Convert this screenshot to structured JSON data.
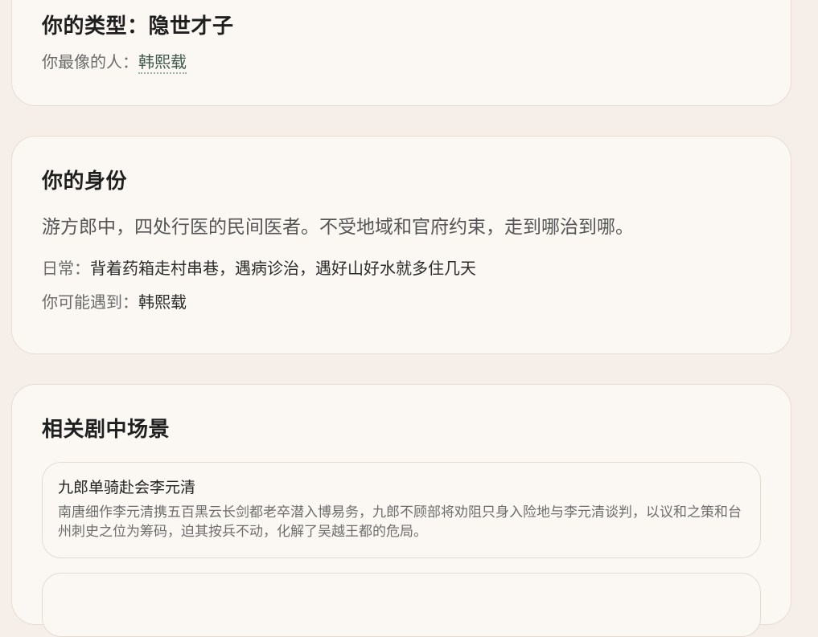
{
  "type_card": {
    "title": "你的类型：隐世才子",
    "resemble_label": "你最像的人：",
    "resemble_name": "韩熙载"
  },
  "identity_card": {
    "title": "你的身份",
    "description": "游方郎中，四处行医的民间医者。不受地域和官府约束，走到哪治到哪。",
    "daily_label": "日常：",
    "daily_value": "背着药箱走村串巷，遇病诊治，遇好山好水就多住几天",
    "meet_label": "你可能遇到：",
    "meet_value": "韩熙载"
  },
  "scenes_card": {
    "title": "相关剧中场景",
    "scenes": [
      {
        "title": "九郎单骑赴会李元清",
        "description": "南唐细作李元清携五百黑云长剑都老卒潜入博易务，九郎不顾部将劝阻只身入险地与李元清谈判，以议和之策和台州刺史之位为筹码，迫其按兵不动，化解了吴越王都的危局。"
      },
      {
        "title": "",
        "description": ""
      }
    ]
  }
}
